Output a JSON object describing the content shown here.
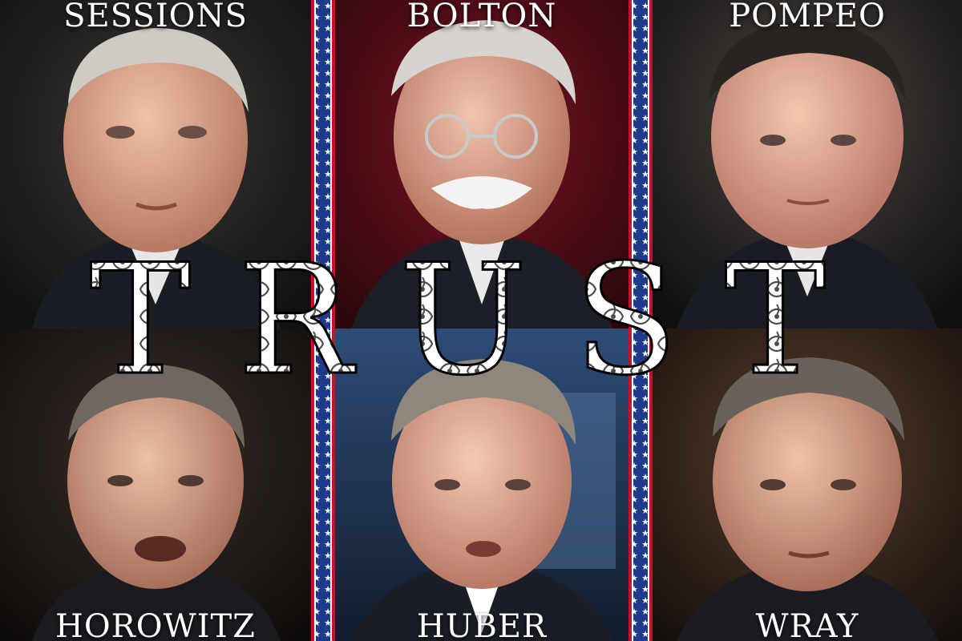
{
  "collage": {
    "title": "TRUST",
    "names": {
      "top_left": "SESSIONS",
      "top_center": "BOLTON",
      "top_right": "POMPEO",
      "bottom_left": "HOROWITZ",
      "bottom_center": "HUBER",
      "bottom_right": "WRAY"
    }
  },
  "colors": {
    "flag_blue": "#1f3a8a",
    "flag_red": "#c8102e",
    "flag_white": "#ffffff",
    "title_fill": "#ffffff",
    "title_ornament": "#111111"
  }
}
